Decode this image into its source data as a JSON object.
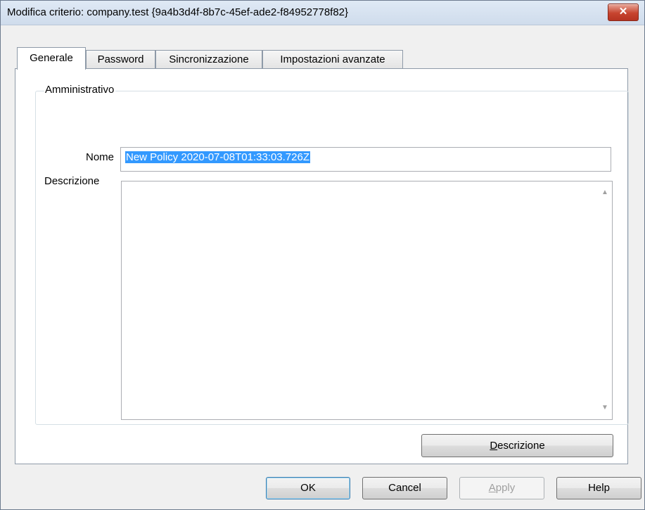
{
  "window": {
    "title": "Modifica criterio:  company.test {9a4b3d4f-8b7c-45ef-ade2-f84952778f82}",
    "close_glyph": "✕"
  },
  "tabs": [
    {
      "label": "Generale",
      "active": true
    },
    {
      "label": "Password",
      "active": false
    },
    {
      "label": "Sincronizzazione",
      "active": false
    },
    {
      "label": "Impostazioni avanzate",
      "active": false
    }
  ],
  "group": {
    "legend": "Amministrativo",
    "name_label": "Nome",
    "name_value": "New Policy 2020-07-08T01:33:03.726Z",
    "description_label": "Descrizione",
    "description_value": "",
    "description_button": {
      "pre": "",
      "mnemonic": "D",
      "post": "escrizione"
    }
  },
  "buttons": {
    "ok": "OK",
    "cancel": "Cancel",
    "apply": {
      "mnemonic": "A",
      "post": "pply"
    },
    "help": "Help"
  },
  "icons": {
    "close": "close-icon",
    "scroll_up": "scroll-up-arrow-icon",
    "scroll_down": "scroll-down-arrow-icon"
  },
  "colors": {
    "selection": "#3399ff",
    "close_button": "#c7442f",
    "titlebar": "#dfe9f5"
  }
}
